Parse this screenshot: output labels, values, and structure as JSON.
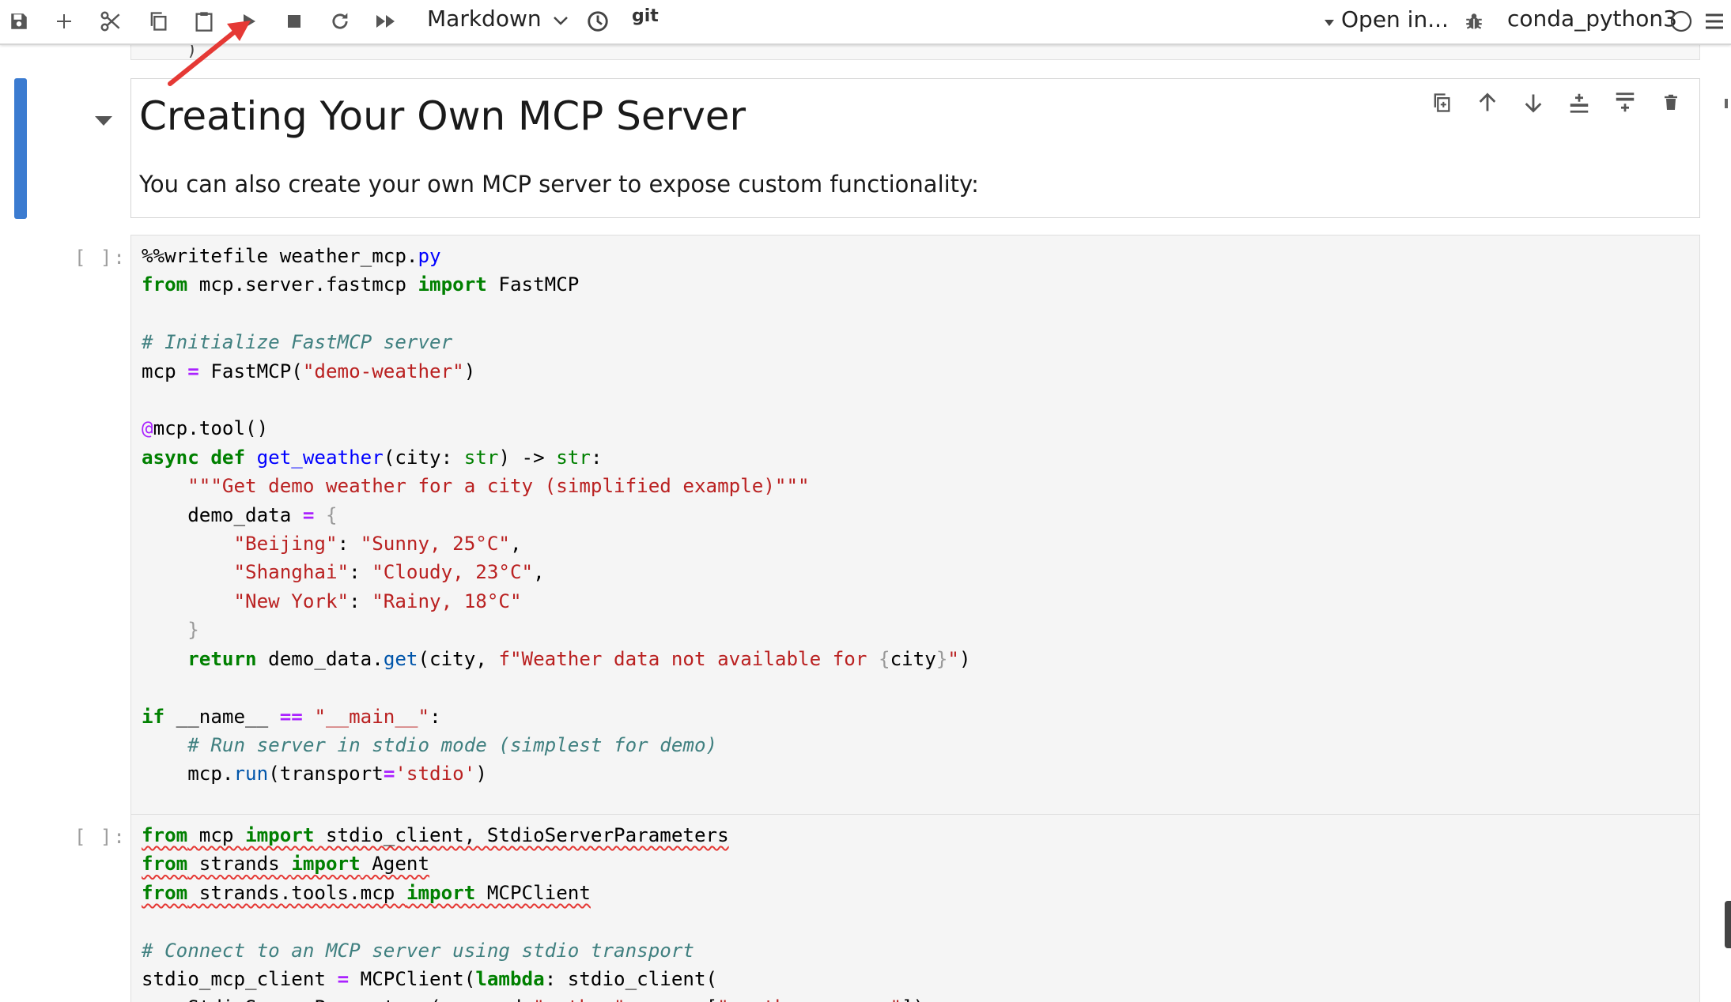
{
  "toolbar": {
    "cell_type": "Markdown",
    "git_label": "git",
    "open_in_label": "Open in...",
    "kernel_name": "conda_python3",
    "icons": [
      "save-icon",
      "add-cell-icon",
      "cut-icon",
      "copy-icon",
      "paste-icon",
      "run-icon",
      "stop-icon",
      "restart-icon",
      "fast-forward-icon",
      "chevron-down-icon",
      "clock-icon",
      "bug-icon",
      "kernel-idle-icon",
      "menu-icon"
    ]
  },
  "markdown_cell": {
    "heading": "Creating Your Own MCP Server",
    "paragraph": "You can also create your own MCP server to expose custom functionality:"
  },
  "code_cells": [
    {
      "prompt": "[ ]:"
    },
    {
      "prompt": "[ ]:"
    }
  ],
  "colors": {
    "active_cell_bar": "#3b7bd0",
    "annotation_arrow": "#e53935",
    "keyword": "#008000",
    "string": "#ba2121",
    "comment": "#408080"
  }
}
